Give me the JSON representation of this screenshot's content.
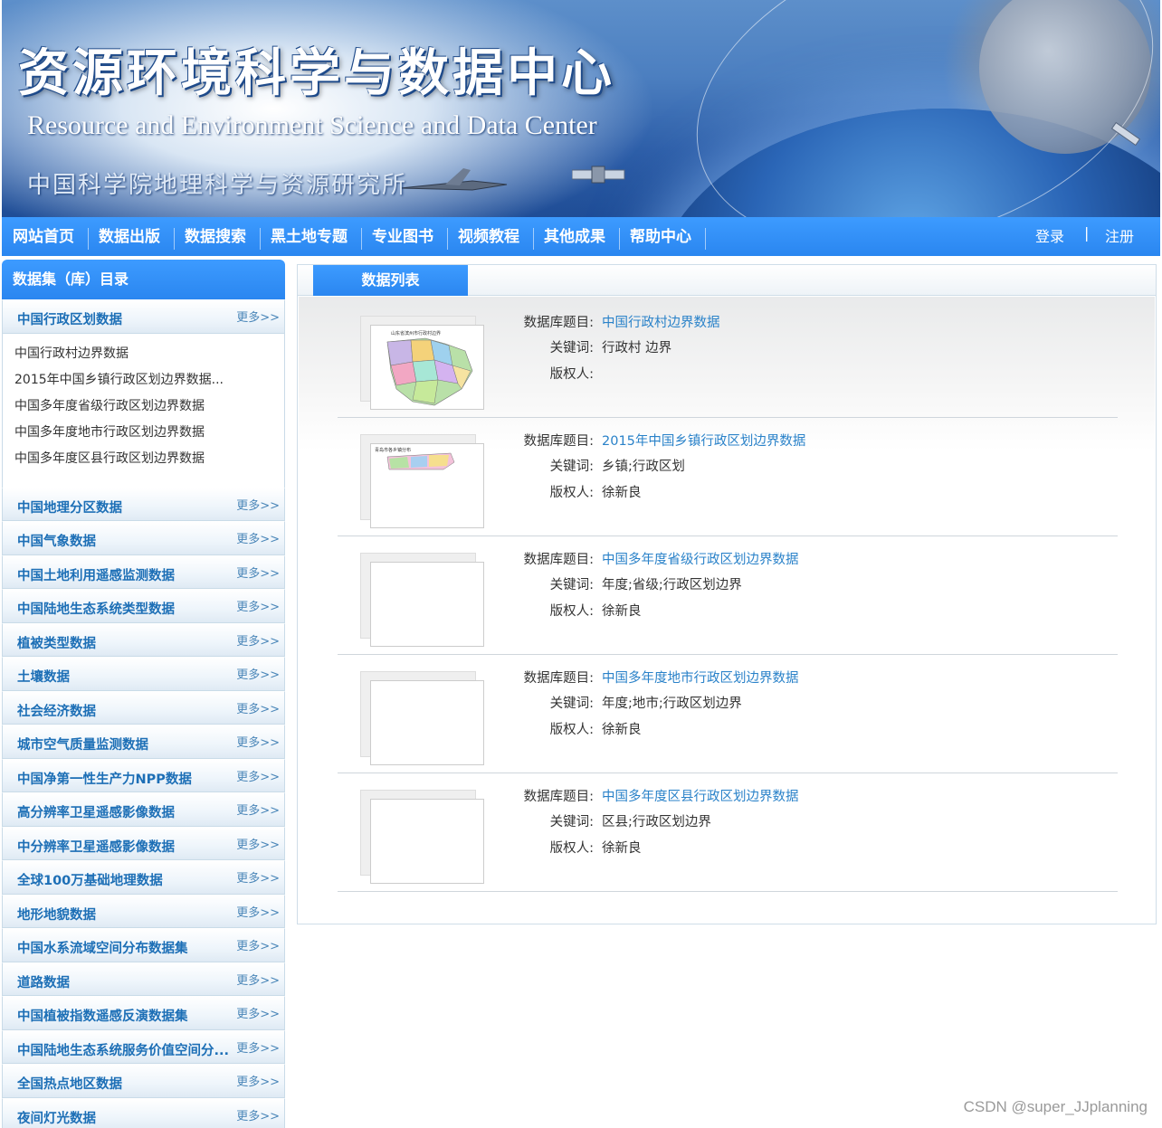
{
  "banner": {
    "title_cn": "资源环境科学与数据中心",
    "title_en": "Resource and Environment Science and Data Center",
    "org": "中国科学院地理科学与资源研究所"
  },
  "nav": {
    "items": [
      "网站首页",
      "数据出版",
      "数据搜索",
      "黑土地专题",
      "专业图书",
      "视频教程",
      "其他成果",
      "帮助中心"
    ],
    "login": "登录",
    "divider": "|",
    "register": "注册"
  },
  "sidebar": {
    "header": "数据集（库）目录",
    "more_label": "更多>>",
    "expanded": {
      "name": "中国行政区划数据",
      "items": [
        "中国行政村边界数据",
        "2015年中国乡镇行政区划边界数据...",
        "中国多年度省级行政区划边界数据",
        "中国多年度地市行政区划边界数据",
        "中国多年度区县行政区划边界数据"
      ]
    },
    "categories": [
      "中国地理分区数据",
      "中国气象数据",
      "中国土地利用遥感监测数据",
      "中国陆地生态系统类型数据",
      "植被类型数据",
      "土壤数据",
      "社会经济数据",
      "城市空气质量监测数据",
      "中国净第一性生产力NPP数据",
      "高分辨率卫星遥感影像数据",
      "中分辨率卫星遥感影像数据",
      "全球100万基础地理数据",
      "地形地貌数据",
      "中国水系流域空间分布数据集",
      "道路数据",
      "中国植被指数遥感反演数据集",
      "中国陆地生态系统服务价值空间分...",
      "全国热点地区数据",
      "夜间灯光数据"
    ]
  },
  "main": {
    "tab_label": "数据列表",
    "labels": {
      "title": "数据库题目:",
      "keywords": "关键词:",
      "owner": "版权人:"
    },
    "entries": [
      {
        "title": "中国行政村边界数据",
        "keywords": "行政村 边界",
        "owner": "",
        "thumb_caption": "山东省滨州市行政村边界"
      },
      {
        "title": "2015年中国乡镇行政区划边界数据",
        "keywords": "乡镇;行政区划",
        "owner": "徐新良",
        "thumb_caption": "青岛市各乡镇分布"
      },
      {
        "title": "中国多年度省级行政区划边界数据",
        "keywords": "年度;省级;行政区划边界",
        "owner": "徐新良",
        "thumb_caption": ""
      },
      {
        "title": "中国多年度地市行政区划边界数据",
        "keywords": "年度;地市;行政区划边界",
        "owner": "徐新良",
        "thumb_caption": ""
      },
      {
        "title": "中国多年度区县行政区划边界数据",
        "keywords": "区县;行政区划边界",
        "owner": "徐新良",
        "thumb_caption": ""
      }
    ]
  },
  "watermark": "CSDN @super_JJplanning",
  "colors": {
    "nav_blue": "#2a86f0",
    "link_blue": "#2a82c9",
    "category_blue": "#1d6fb6"
  }
}
